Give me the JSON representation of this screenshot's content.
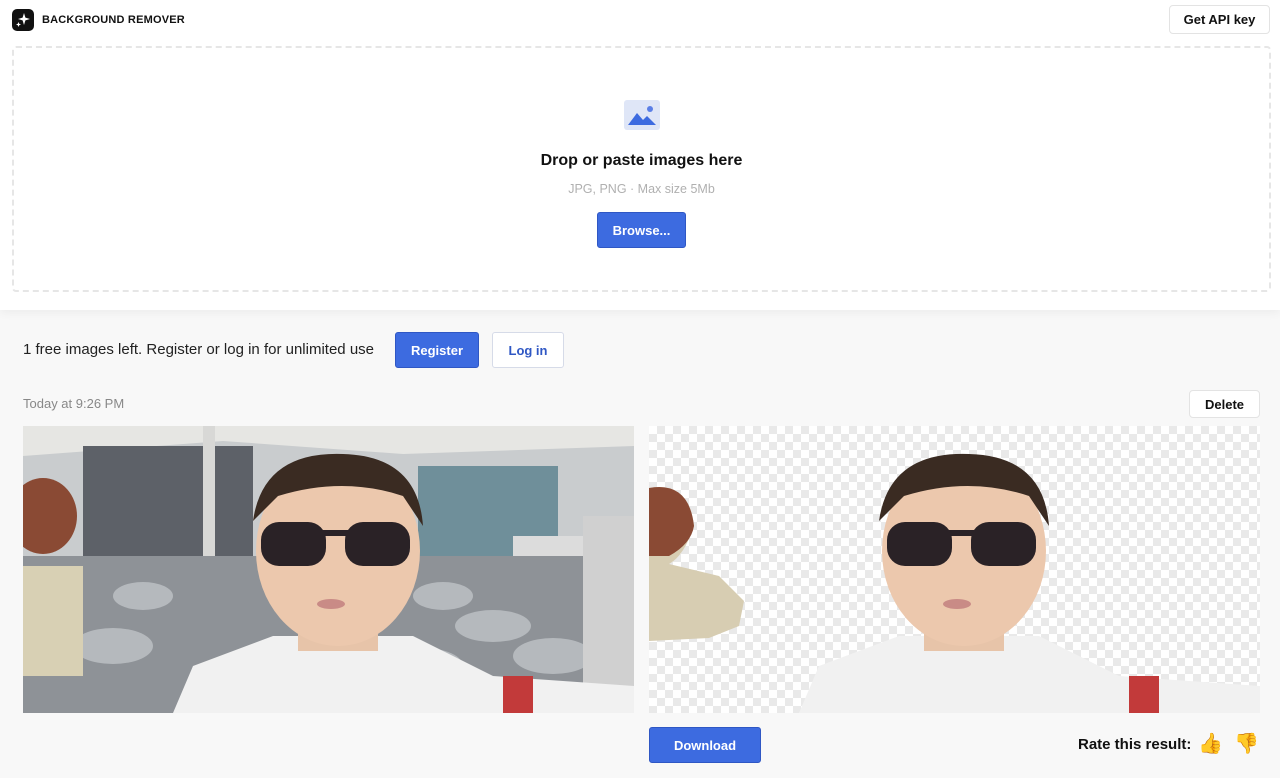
{
  "header": {
    "brand": "BACKGROUND REMOVER",
    "api_button": "Get API key"
  },
  "upload": {
    "icon": "image-icon",
    "title": "Drop or paste images here",
    "subtitle": "JPG, PNG · Max size 5Mb",
    "browse_button": "Browse..."
  },
  "account": {
    "notice": "1 free images left. Register or log in for unlimited use",
    "register_button": "Register",
    "login_button": "Log in"
  },
  "result": {
    "timestamp": "Today at 9:26 PM",
    "delete_button": "Delete",
    "original_image": "original-photo",
    "processed_image": "background-removed-photo",
    "download_button": "Download",
    "rate_label": "Rate this result:",
    "thumbs_up": "👍",
    "thumbs_down": "👎"
  },
  "colors": {
    "accent": "#3d6be0",
    "page_bg": "#f8f8f8"
  }
}
